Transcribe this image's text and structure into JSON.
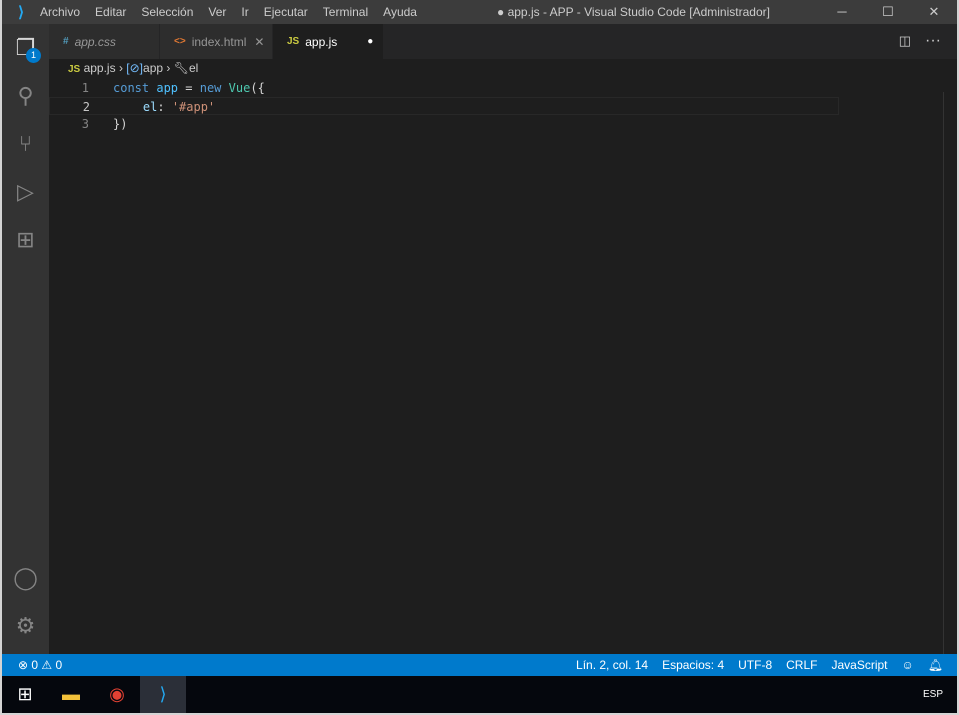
{
  "menu": [
    "Archivo",
    "Editar",
    "Selección",
    "Ver",
    "Ir",
    "Ejecutar",
    "Terminal",
    "Ayuda"
  ],
  "window_title": "● app.js - APP - Visual Studio Code [Administrador]",
  "explorer_badge": "1",
  "tabs": [
    {
      "label": "app.css",
      "icon": "#"
    },
    {
      "label": "index.html",
      "icon": "<>"
    },
    {
      "label": "app.js",
      "icon": "JS"
    }
  ],
  "breadcrumb": [
    "app.js",
    "app",
    "el"
  ],
  "code": [
    "1",
    "2",
    "3"
  ],
  "status": {
    "errors": "0",
    "warnings": "0",
    "position": "Lín. 2, col. 14",
    "spaces": "Espacios: 4",
    "encoding": "UTF-8",
    "eol": "CRLF",
    "language": "JavaScript"
  },
  "taskbar": {
    "lang": "ESP"
  }
}
